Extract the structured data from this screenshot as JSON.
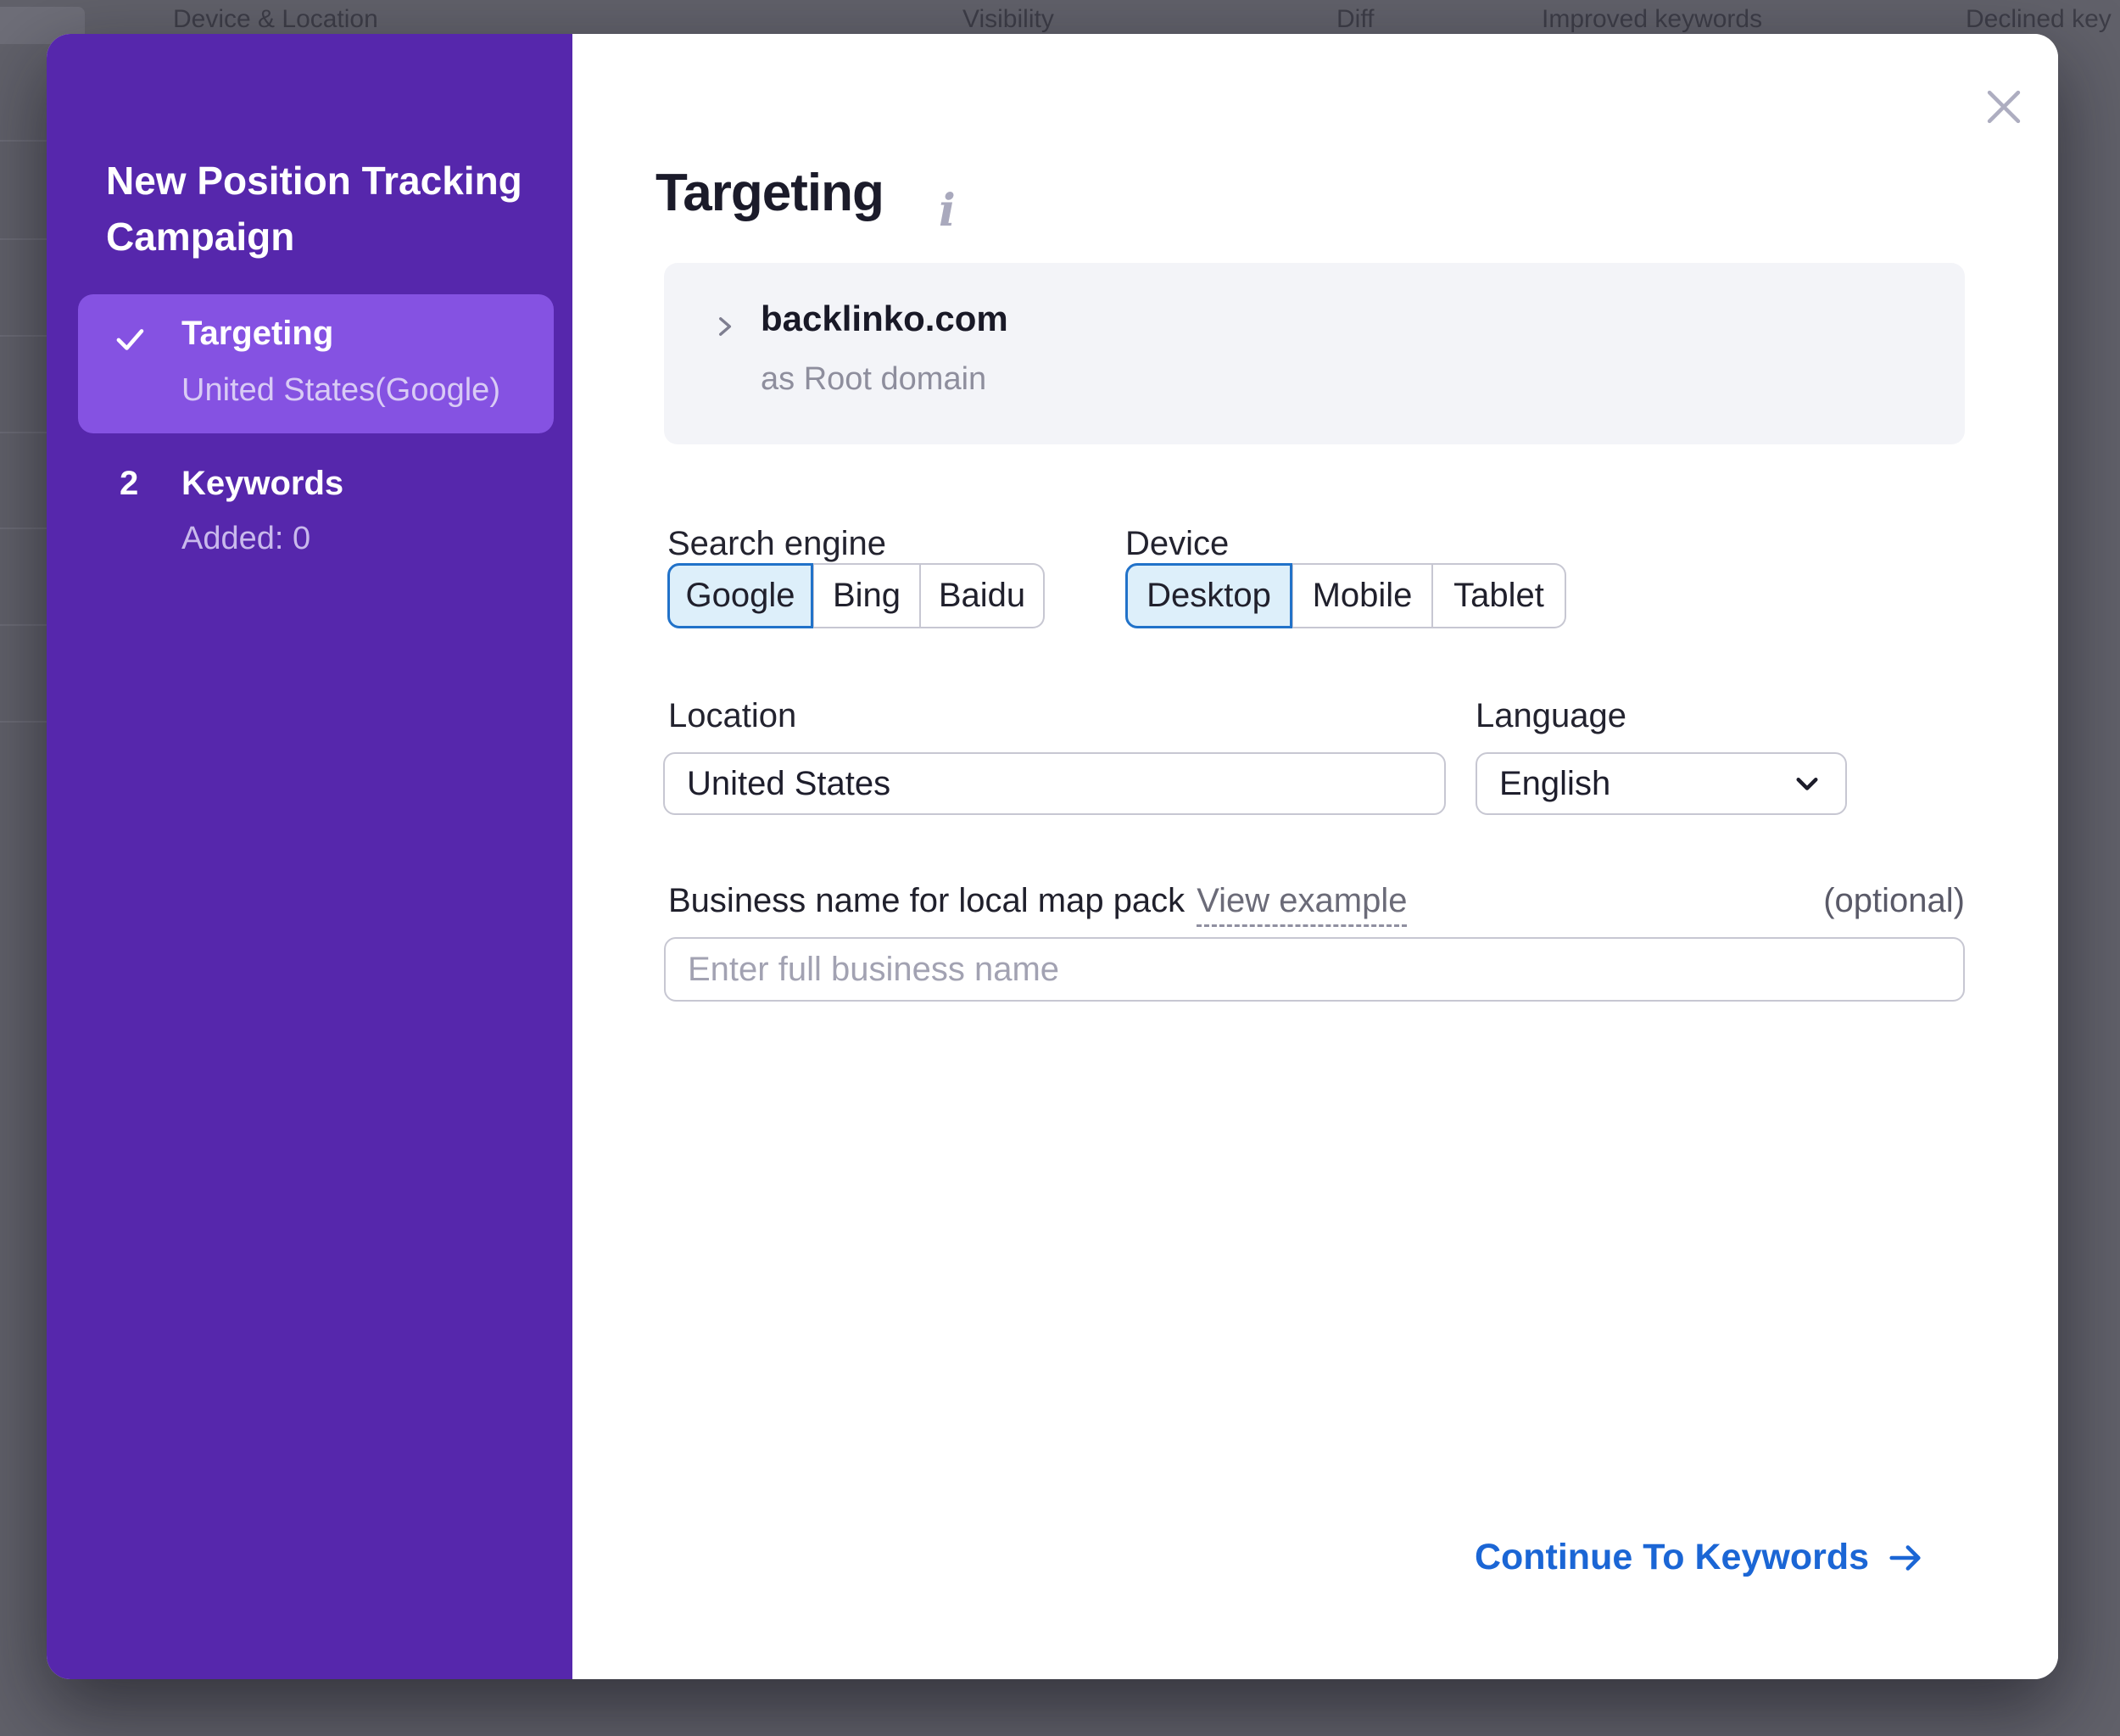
{
  "background": {
    "columns": [
      "Device & Location",
      "Visibility",
      "Diff",
      "Improved keywords",
      "Declined key"
    ]
  },
  "sidebar": {
    "title": "New Position Tracking Campaign",
    "steps": [
      {
        "label": "Targeting",
        "sublabel": "United States(Google)",
        "state": "completed-active"
      },
      {
        "number": "2",
        "label": "Keywords",
        "sublabel": "Added: 0",
        "state": "upcoming"
      }
    ]
  },
  "dialog": {
    "title": "Targeting",
    "info_icon": "i",
    "domain": {
      "name": "backlinko.com",
      "scope": "as Root domain"
    },
    "search_engine": {
      "label": "Search engine",
      "options": [
        "Google",
        "Bing",
        "Baidu"
      ],
      "selected": "Google"
    },
    "device": {
      "label": "Device",
      "options": [
        "Desktop",
        "Mobile",
        "Tablet"
      ],
      "selected": "Desktop"
    },
    "location": {
      "label": "Location",
      "value": "United States"
    },
    "language": {
      "label": "Language",
      "value": "English"
    },
    "business_name": {
      "label": "Business name for local map pack",
      "link": "View example",
      "optional_note": "(optional)",
      "placeholder": "Enter full business name"
    },
    "footer": {
      "continue_label": "Continue To Keywords"
    }
  },
  "colors": {
    "sidebar_purple": "#5627ac",
    "active_step_purple": "#8552e2",
    "selected_segment_bg": "#ddeffa",
    "selected_segment_border": "#2172c9",
    "link_blue": "#1b66d5",
    "overlay_gray": "#61616a"
  }
}
